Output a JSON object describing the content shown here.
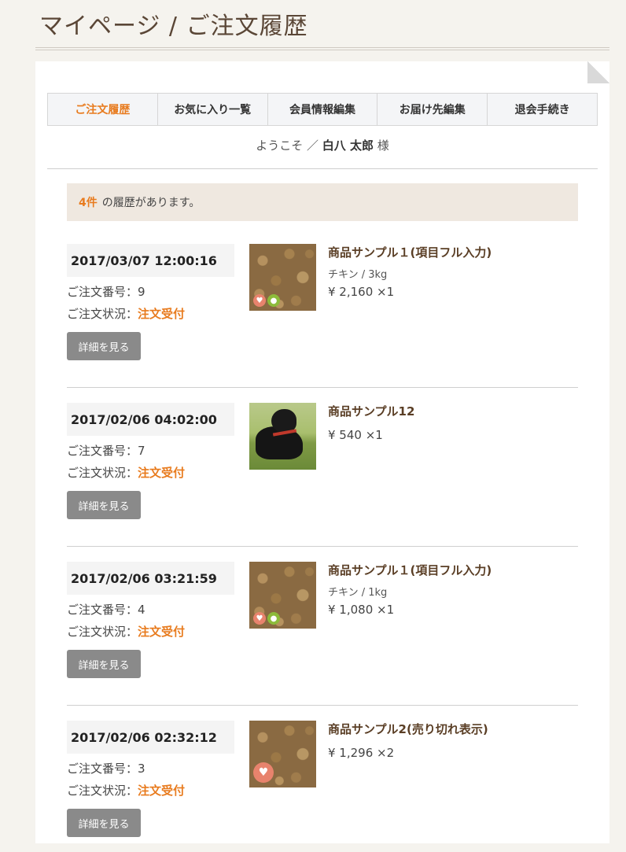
{
  "page_title": "マイページ / ご注文履歴",
  "tabs": [
    {
      "label": "ご注文履歴",
      "active": true
    },
    {
      "label": "お気に入り一覧",
      "active": false
    },
    {
      "label": "会員情報編集",
      "active": false
    },
    {
      "label": "お届け先編集",
      "active": false
    },
    {
      "label": "退会手続き",
      "active": false
    }
  ],
  "welcome": {
    "prefix": "ようこそ ／",
    "name": "白八 太郎",
    "suffix": "様"
  },
  "history": {
    "count": "4件",
    "text": "の履歴があります。"
  },
  "labels": {
    "order_no": "ご注文番号：",
    "order_status": "ご注文状況：",
    "detail_button": "詳細を見る"
  },
  "orders": [
    {
      "date": "2017/03/07 12:00:16",
      "order_no": "9",
      "status": "注文受付",
      "product": "商品サンプル１(項目フル入力)",
      "variant": "チキン / 3kg",
      "price": "¥ 2,160 ×1",
      "image": "dog-food-icon"
    },
    {
      "date": "2017/02/06 04:02:00",
      "order_no": "7",
      "status": "注文受付",
      "product": "商品サンプル12",
      "variant": "",
      "price": "¥ 540 ×1",
      "image": "dog-photo"
    },
    {
      "date": "2017/02/06 03:21:59",
      "order_no": "4",
      "status": "注文受付",
      "product": "商品サンプル１(項目フル入力)",
      "variant": "チキン / 1kg",
      "price": "¥ 1,080 ×1",
      "image": "dog-food-icon"
    },
    {
      "date": "2017/02/06 02:32:12",
      "order_no": "3",
      "status": "注文受付",
      "product": "商品サンプル2(売り切れ表示)",
      "variant": "",
      "price": "¥ 1,296 ×2",
      "image": "dog-food-icon"
    }
  ],
  "colors": {
    "accent": "#e87b1e",
    "title": "#5a4636",
    "button": "#8a8a8a"
  }
}
